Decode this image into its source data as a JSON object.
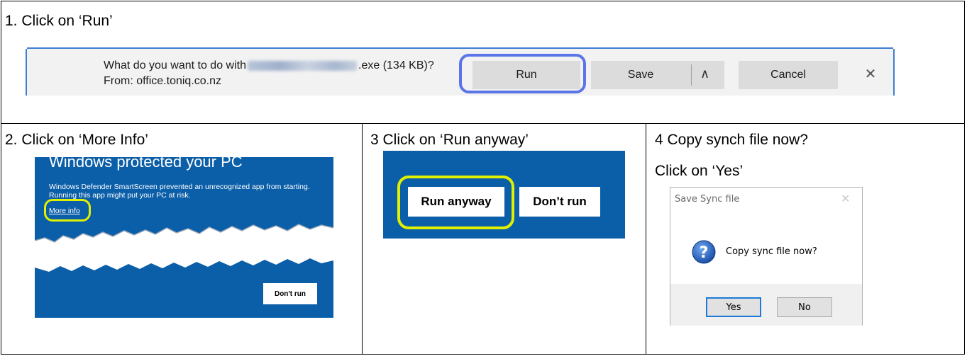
{
  "steps": {
    "step1": "1. Click on ‘Run’",
    "step2": "2. Click on ‘More Info’",
    "step3": "3 Click on ‘Run anyway’",
    "step4_line1": "4 Copy synch file now?",
    "step4_line2": "Click on ‘Yes’"
  },
  "download_bar": {
    "question_prefix": "What do you want to do with",
    "question_suffix": ".exe (134 KB)?",
    "from": "From: office.toniq.co.nz",
    "run_label": "Run",
    "save_label": "Save",
    "cancel_label": "Cancel",
    "close_glyph": "✕",
    "chevron_glyph": "∧"
  },
  "smartscreen": {
    "title": "Windows protected your PC",
    "body": "Windows Defender SmartScreen prevented an unrecognized app from starting. Running this app might put your PC at risk.",
    "more_info": "More info",
    "dont_run": "Don't run"
  },
  "run_anyway_panel": {
    "run_anyway": "Run anyway",
    "dont_run": "Don’t run"
  },
  "dialog": {
    "title": "Save Sync file",
    "message": "Copy sync file now?",
    "yes": "Yes",
    "no": "No",
    "close_glyph": "✕"
  },
  "colors": {
    "smartscreen_blue": "#0b5ea8",
    "highlight_blue": "#5b74e8",
    "highlight_yellow": "#e0f000",
    "bar_button": "#dcdcdc"
  }
}
